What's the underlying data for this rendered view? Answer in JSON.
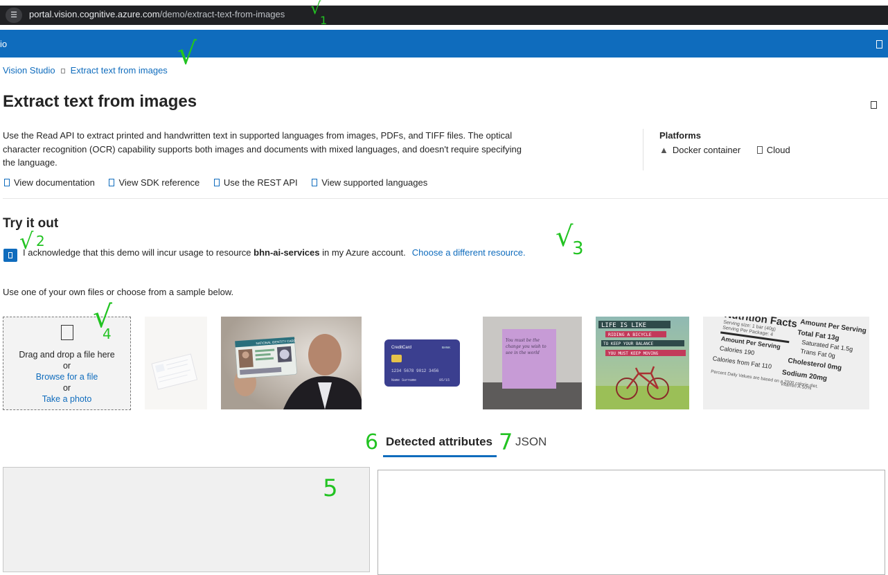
{
  "browser": {
    "url_host": "portal.vision.cognitive.azure.com",
    "url_path": "/demo/extract-text-from-images",
    "site_icon": "tune-icon"
  },
  "appbar": {
    "name": "io"
  },
  "breadcrumb": {
    "root": "Vision Studio",
    "current": "Extract text from images"
  },
  "page": {
    "title": "Extract text from images",
    "description": "Use the Read API to extract printed and handwritten text in supported languages from images, PDFs, and TIFF files. The optical character recognition (OCR) capability supports both images and documents with mixed languages, and doesn't require specifying the language."
  },
  "platforms": {
    "heading": "Platforms",
    "items": [
      "Docker container",
      "Cloud"
    ]
  },
  "links": [
    "View documentation",
    "View SDK reference",
    "Use the REST API",
    "View supported languages"
  ],
  "try": {
    "heading": "Try it out",
    "ack_prefix": "I acknowledge that this demo will incur usage to resource ",
    "resource": "bhn-ai-services",
    "ack_suffix": " in my Azure account.",
    "change_resource": "Choose a different resource.",
    "use_own": "Use one of your own files or choose from a sample below."
  },
  "dropzone": {
    "drag": "Drag and drop a file here",
    "or1": "or",
    "browse": "Browse for a file",
    "or2": "or",
    "photo": "Take a photo"
  },
  "samples": {
    "id_card": "NATIONAL IDENTITY CARD",
    "credit_card": {
      "brand": "CreditCard",
      "bank": "BANK",
      "number": "1234 5678 9012 3456",
      "name": "Name Surname",
      "expiry": "05/15"
    },
    "sticky_note": "You must be the change you wish to see in the world",
    "poster": [
      "LIFE IS LIKE",
      "RIDING A BICYCLE",
      "TO KEEP YOUR BALANCE",
      "YOU MUST KEEP MOVING"
    ],
    "nutrition": {
      "title": "Nutrition Facts",
      "serving": "Serving size: 1 bar (40g)",
      "per_package": "Serving Per Package: 4",
      "amount": "Amount Per Serving",
      "calories": "Calories 190",
      "fat_cal": "Calories from Fat 110",
      "total_fat": "Total Fat 13g",
      "sat_fat": "Saturated Fat 1.5g",
      "trans_fat": "Trans Fat 0g",
      "chol": "Cholesterol 0mg",
      "sodium": "Sodium 20mg",
      "daily": "Percent Daily Values are based on a 2000 calorie diet.",
      "vit": "Vitamin A 50%"
    }
  },
  "tabs": {
    "detected": "Detected attributes",
    "json": "JSON"
  },
  "annotations": {
    "a1": "√",
    "n1": "1",
    "a2": "√",
    "n2": "2",
    "a3": "√",
    "n3": "3",
    "a4": "√",
    "n4": "4",
    "n5": "5",
    "n6": "6",
    "n7": "7",
    "a_bc": "√"
  },
  "colors": {
    "accent": "#0f6cbd",
    "annotation": "#22c322"
  }
}
